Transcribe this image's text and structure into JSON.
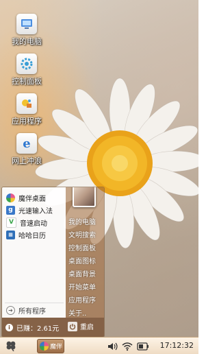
{
  "desktop_icons": [
    {
      "label": "我的电脑",
      "icon": "my-computer-icon"
    },
    {
      "label": "控制面板",
      "icon": "control-panel-icon"
    },
    {
      "label": "应用程序",
      "icon": "applications-icon"
    },
    {
      "label": "网上冲浪",
      "icon": "internet-browser-icon"
    }
  ],
  "start_menu": {
    "programs": [
      {
        "label": "魔伴桌面",
        "icon": "magic-desktop-icon",
        "color": "#e85a8c"
      },
      {
        "label": "光速输入法",
        "icon": "input-method-icon",
        "color": "#3a78c8"
      },
      {
        "label": "音速启动",
        "icon": "launcher-icon",
        "color": "#3aa54a"
      },
      {
        "label": "哈哈日历",
        "icon": "calendar-icon",
        "color": "#2f6fb8"
      }
    ],
    "all_programs_label": "所有程序",
    "right_items": [
      "我的电脑",
      "文明搜索",
      "控制面板",
      "桌面图标",
      "桌面背景",
      "开始菜单",
      "应用程序",
      "关于.."
    ],
    "earned_text": "已赚：2.61元",
    "restart_label": "重启"
  },
  "taskbar": {
    "task_label": "魔伴",
    "clock": "17:12:32",
    "tray_icons": [
      "volume-icon",
      "wifi-icon",
      "battery-icon"
    ]
  },
  "colors": {
    "menu_right_bg": "#a0693c",
    "taskbar_bg": "#f5e6d2"
  }
}
